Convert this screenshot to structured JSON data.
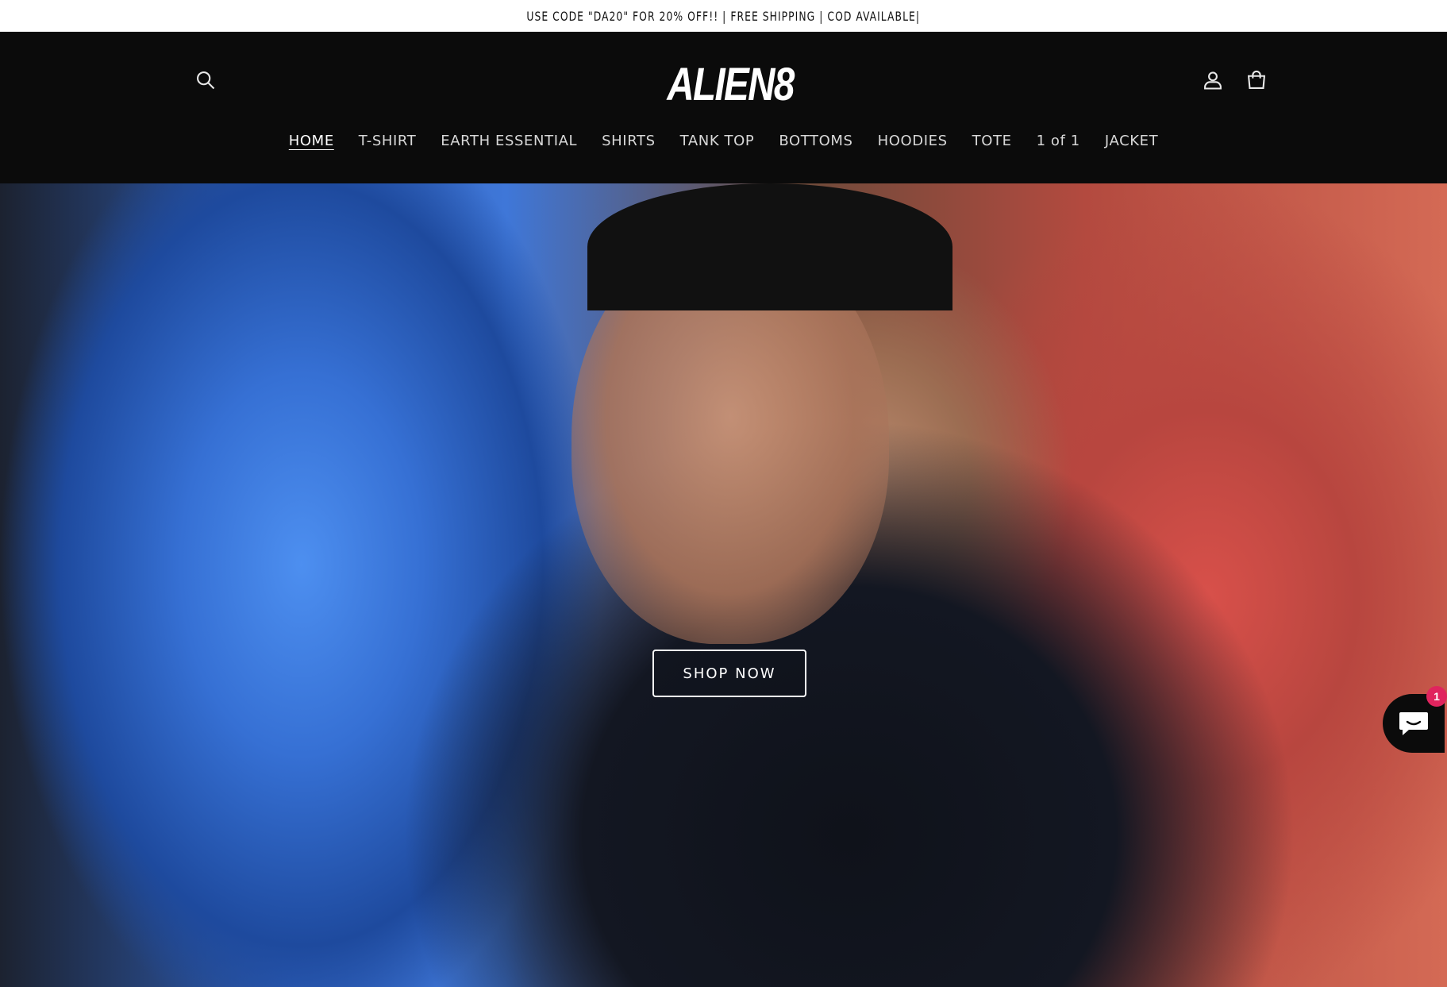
{
  "announcement": {
    "text": "USE CODE \"DA20\" FOR 20% OFF!! | FREE SHIPPING | COD AVAILABLE|"
  },
  "header": {
    "logo_text": "ALIEN8",
    "icons": {
      "search": "search-icon",
      "account": "user-icon",
      "cart": "cart-icon"
    }
  },
  "nav": {
    "items": [
      {
        "label": "HOME",
        "active": true
      },
      {
        "label": "T-SHIRT"
      },
      {
        "label": "EARTH ESSENTIAL"
      },
      {
        "label": "SHIRTS"
      },
      {
        "label": "TANK TOP"
      },
      {
        "label": "BOTTOMS"
      },
      {
        "label": "HOODIES"
      },
      {
        "label": "TOTE"
      },
      {
        "label": "1 of 1"
      },
      {
        "label": "JACKET"
      }
    ]
  },
  "hero": {
    "cta_label": "SHOP NOW"
  },
  "chat": {
    "badge_count": "1",
    "icon": "chat-icon",
    "badge_color": "#e0245e"
  },
  "colors": {
    "header_bg": "#0b0b0b",
    "announcement_bg": "#ffffff",
    "accent": "#ffffff"
  }
}
